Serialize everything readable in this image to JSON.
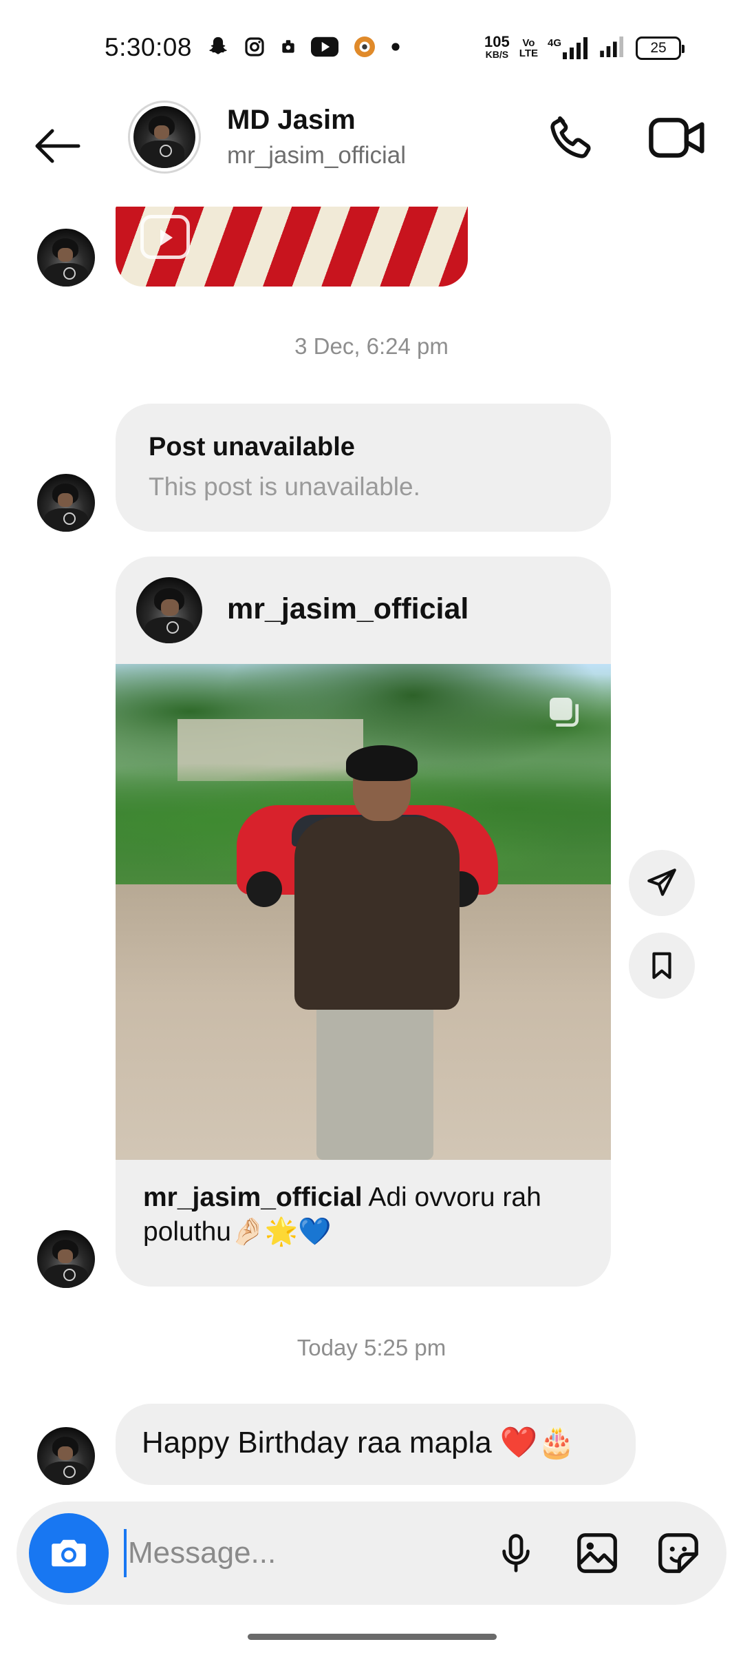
{
  "status_bar": {
    "time": "5:30:08",
    "net_speed_value": "105",
    "net_speed_unit": "KB/S",
    "volte_line1": "Vo",
    "volte_line2": "LTE",
    "network": "4G",
    "battery": "25"
  },
  "header": {
    "name": "MD Jasim",
    "username": "mr_jasim_official"
  },
  "messages": {
    "timestamp_1": "3 Dec, 6:24 pm",
    "unavailable_title": "Post unavailable",
    "unavailable_subtitle": "This post is unavailable.",
    "post": {
      "username": "mr_jasim_official",
      "caption_user": "mr_jasim_official",
      "caption_text": " Adi ovvoru rah poluthu🤌🏻🌟💙"
    },
    "timestamp_2": "Today 5:25 pm",
    "last_message": "Happy Birthday raa mapla ❤️🎂"
  },
  "composer": {
    "placeholder": "Message..."
  },
  "colors": {
    "accent": "#1877f2",
    "bubble": "#efefef",
    "muted": "#8e8e8e"
  }
}
